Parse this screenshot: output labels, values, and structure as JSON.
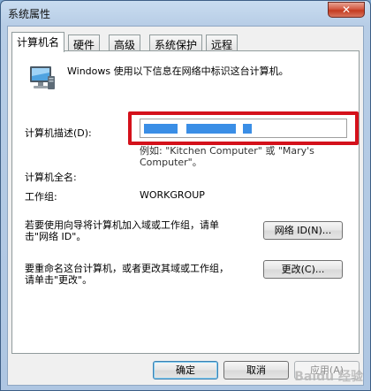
{
  "window": {
    "title": "系统属性",
    "close_glyph": "✕"
  },
  "tabs": [
    {
      "label": "计算机名"
    },
    {
      "label": "硬件"
    },
    {
      "label": "高级"
    },
    {
      "label": "系统保护"
    },
    {
      "label": "远程"
    }
  ],
  "panel": {
    "intro": "Windows 使用以下信息在网络中标识这台计算机。",
    "desc_label": "计算机描述(D):",
    "desc_value": "",
    "example_line1": "例如: \"Kitchen Computer\" 或 \"Mary's",
    "example_line2": "Computer\"。",
    "full_name_label": "计算机全名:",
    "full_name_value": "",
    "workgroup_label": "工作组:",
    "workgroup_value": "WORKGROUP",
    "netid_text_line1": "若要使用向导将计算机加入域或工作组，请单",
    "netid_text_line2": "击\"网络 ID\"。",
    "netid_button": "网络 ID(N)...",
    "rename_text_line1": "要重命名这台计算机，或者更改其域或工作组，",
    "rename_text_line2": "请单击\"更改\"。",
    "change_button": "更改(C)..."
  },
  "footer": {
    "ok": "确定",
    "cancel": "取消",
    "apply": "应用(A)",
    "watermark": "Baidu 经验"
  },
  "icons": {
    "monitor": "computer-monitor-icon"
  },
  "colors": {
    "highlight_box": "#d4111b",
    "redaction": "#3a8ee6"
  }
}
